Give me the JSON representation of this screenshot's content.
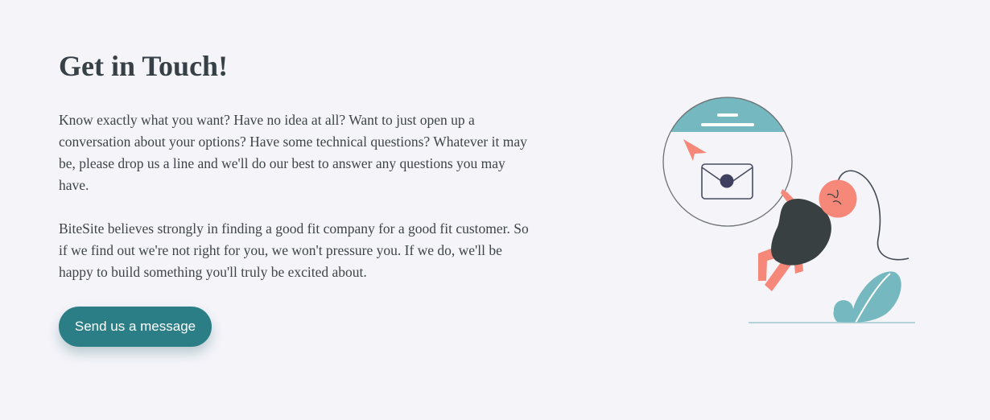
{
  "contact": {
    "title": "Get in Touch!",
    "paragraph_1": "Know exactly what you want? Have no idea at all? Want to just open up a conversation about your options? Have some technical questions? Whatever it may be, please drop us a line and we'll do our best to answer any questions you may have.",
    "paragraph_2": "BiteSite believes strongly in finding a good fit company for a good fit customer. So if we find out we're not right for you, we won't pressure you. If we do, we'll be happy to build something you'll truly be excited about.",
    "cta_label": "Send us a message"
  },
  "illustration": {
    "icon": "contact-mail-illustration",
    "colors": {
      "teal": "#75b8c0",
      "coral": "#f68879",
      "dark": "#384042",
      "accent": "#3f4060"
    }
  }
}
